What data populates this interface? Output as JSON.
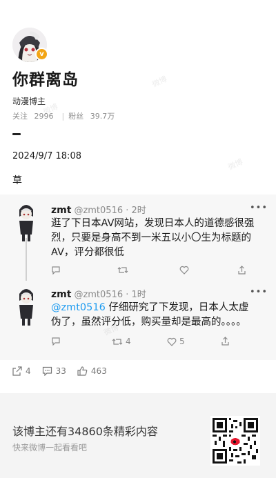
{
  "profile": {
    "name": "你群离岛",
    "tag": "动漫博主",
    "stats": {
      "follow_label": "关注",
      "follow_count": "2996",
      "fans_label": "粉丝",
      "fans_count": "39.7万"
    },
    "badge_icon": "verified-v-icon"
  },
  "post": {
    "date": "2024/9/7 18:08",
    "text": "草"
  },
  "embedded_thread": [
    {
      "name": "zmt",
      "handle": "@zmt0516 · 2时",
      "text": "逛了下日本AV网站，发现日本人的道德感很强烈，只要是身高不到一米五以小〇生为标题的AV，评分都很低",
      "actions": {
        "reply": "",
        "retweet": "",
        "like": ""
      }
    },
    {
      "name": "zmt",
      "handle": "@zmt0516 · 1时",
      "mention": "@zmt0516",
      "text": " 仔细研究了下发现，日本人太虚伪了，虽然评分低，购买量却是最高的。。。。",
      "actions": {
        "reply": "",
        "retweet": "4",
        "like": "5"
      }
    }
  ],
  "counts": {
    "repost": "4",
    "comment": "33",
    "like": "463"
  },
  "promo": {
    "title": "该博主还有34860条精彩内容",
    "subtitle": "快来微博一起看看吧"
  },
  "colors": {
    "accent_blue": "#1d9bf0",
    "badge_orange": "#f2a516"
  }
}
